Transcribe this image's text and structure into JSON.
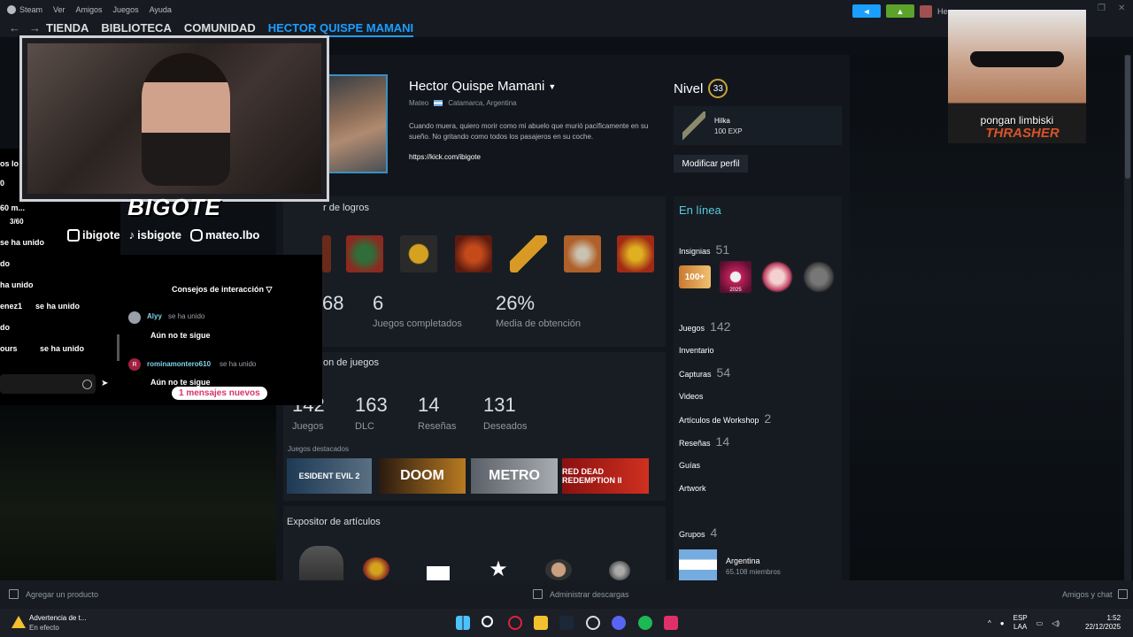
{
  "steam_menu": [
    "Steam",
    "Ver",
    "Amigos",
    "Juegos",
    "Ayuda"
  ],
  "nav": {
    "tabs": [
      "TIENDA",
      "BIBLIOTECA",
      "COMUNIDAD"
    ],
    "active_tab": "HECTOR QUISPE MAMANI"
  },
  "top_right": {
    "user_name": "Hec"
  },
  "profile": {
    "name": "Hector Quispe Mamani",
    "real_name": "Mateo",
    "location": "Catamarca, Argentina",
    "bio": "Cuando muera, quiero morir como mi abuelo que murió pacíficamente en su sueño. No gritando como todos los pasajeros en su coche.",
    "link": "https://kick.com/ibigote"
  },
  "level": {
    "label": "Nivel",
    "value": "33",
    "badge_name": "Hilka",
    "badge_exp": "100 EXP",
    "edit_button": "Modificar perfil"
  },
  "achievements": {
    "title": "r de logros",
    "stats": [
      {
        "value": "68",
        "label": ""
      },
      {
        "value": "6",
        "label": "Juegos completados"
      },
      {
        "value": "26%",
        "label": "Media de obtención"
      }
    ]
  },
  "games": {
    "title": "on de juegos",
    "stats": [
      {
        "value": "142",
        "label": "Juegos"
      },
      {
        "value": "163",
        "label": "DLC"
      },
      {
        "value": "14",
        "label": "Reseñas"
      },
      {
        "value": "131",
        "label": "Deseados"
      }
    ],
    "featured_label": "Juegos destacados",
    "featured": [
      "ESIDENT EVIL 2",
      "DOOM",
      "METRO",
      "RED DEAD REDEMPTION II"
    ]
  },
  "items_showcase": {
    "title": "Expositor de artículos"
  },
  "sidebar": {
    "status": "En línea",
    "badges": {
      "label": "Insignias",
      "count": "51"
    },
    "badge_tiles": [
      "100+",
      "2025",
      "",
      ""
    ],
    "rows": [
      {
        "label": "Juegos",
        "count": "142"
      },
      {
        "label": "Inventario",
        "count": ""
      },
      {
        "label": "Capturas",
        "count": "54"
      },
      {
        "label": "Videos",
        "count": ""
      },
      {
        "label": "Artículos de Workshop",
        "count": "2"
      },
      {
        "label": "Reseñas",
        "count": "14"
      },
      {
        "label": "Guías",
        "count": ""
      },
      {
        "label": "Artwork",
        "count": ""
      }
    ],
    "groups": {
      "label": "Grupos",
      "count": "4",
      "first_name": "Argentina",
      "first_members": "65.108 miembros"
    }
  },
  "stream_overlay": {
    "logo": "BIGOTE",
    "socials": [
      "ibigote",
      "isbigote",
      "mateo.lbo"
    ]
  },
  "chat": {
    "left_lines": [
      "os lo",
      "0",
      "60 m...",
      "3/60",
      "se ha unido",
      "do",
      "ha unido",
      "enez1",
      "se ha unido",
      "do",
      "ours",
      "se ha unido"
    ],
    "title": "Consejos de interacción",
    "messages": [
      {
        "user": "Alyy",
        "action": "se ha unido",
        "text": "Aún no te sigue",
        "user_color": "#7fd4e8"
      },
      {
        "user": "rominamontero610",
        "action": "se ha unido",
        "text": "Aún no te sigue",
        "user_color": "#7fd4e8"
      }
    ],
    "new_messages": "1 mensajes nuevos"
  },
  "cat_sticker": {
    "caption": "pongan limbiski",
    "shirt": "THRASHER"
  },
  "steam_bottom": {
    "add_product": "Agregar un producto",
    "downloads": "Administrar descargas",
    "friends": "Amigos y chat"
  },
  "taskbar": {
    "warning_title": "Advertencia de t...",
    "warning_sub": "En efecto",
    "lang_top": "ESP",
    "lang_bottom": "LAA",
    "time": "1:52",
    "date": "22/12/2025"
  }
}
